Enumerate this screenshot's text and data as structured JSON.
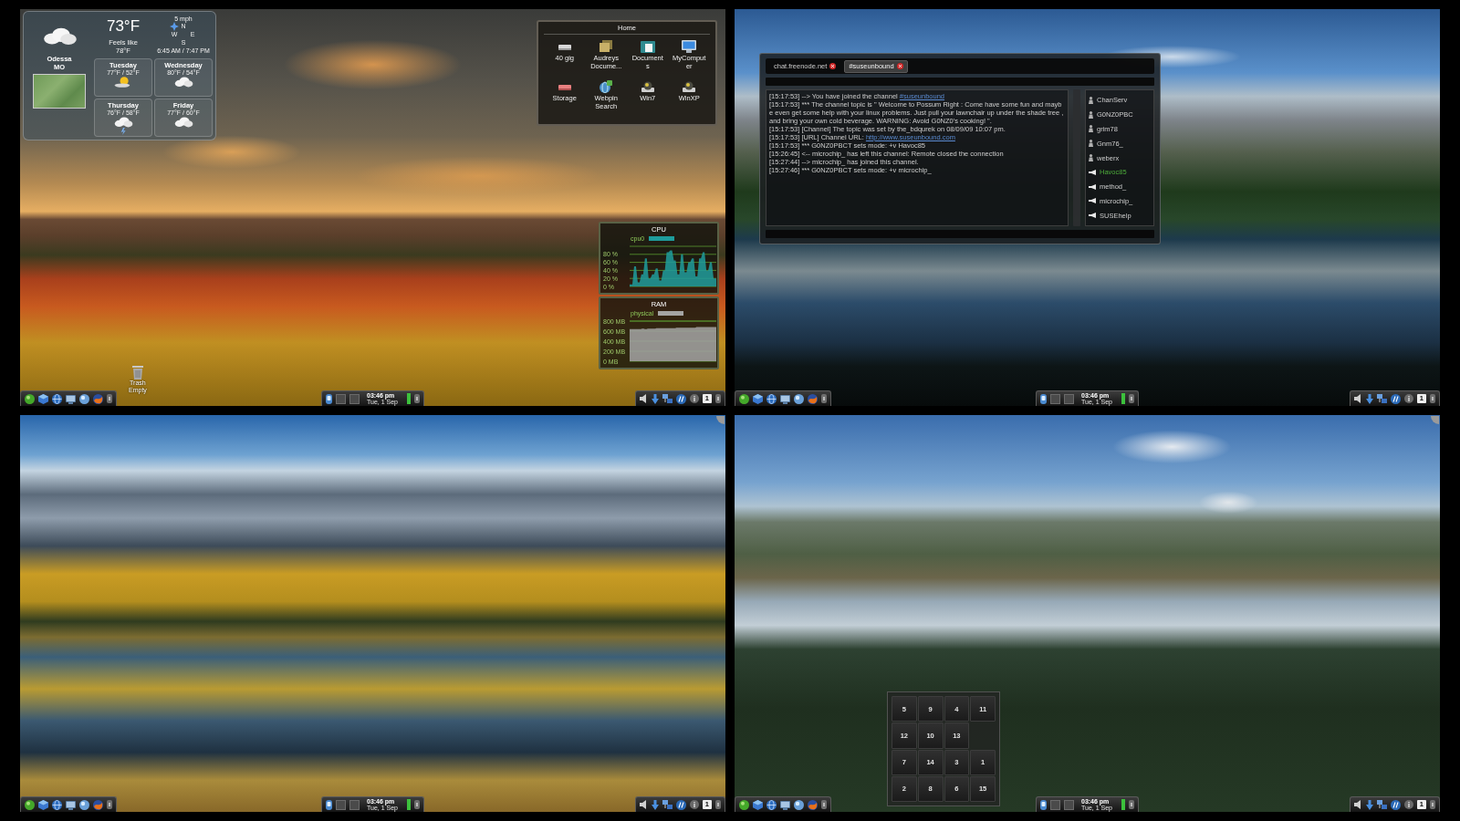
{
  "desktops": [
    {
      "kind": "sunset",
      "toolbox": false,
      "weather": {
        "kind": "cloudy",
        "city": "Odessa",
        "region": "MO",
        "temperature": "73°F",
        "feels_label": "Feels like",
        "feels_value": "78°F",
        "wind": "5 mph",
        "compass": {
          "north": "N",
          "west": "W",
          "east": "E",
          "south": "S"
        },
        "sun_times": "6:45 AM / 7:47 PM",
        "forecast": [
          {
            "day": "Tuesday",
            "temps": "77°F / 52°F",
            "kind": "sunny"
          },
          {
            "day": "Wednesday",
            "temps": "80°F / 54°F",
            "kind": "cloudy"
          },
          {
            "day": "Thursday",
            "temps": "76°F / 58°F",
            "kind": "storm"
          },
          {
            "day": "Friday",
            "temps": "77°F / 60°F",
            "kind": "cloudy"
          }
        ]
      },
      "folder": {
        "title": "Home",
        "items": [
          {
            "label": "40 gig",
            "kind": "drive"
          },
          {
            "label": "Audreys Docume...",
            "kind": "folder"
          },
          {
            "label": "Documents",
            "kind": "documents"
          },
          {
            "label": "MyComputer",
            "kind": "computer"
          },
          {
            "label": "Storage",
            "kind": "storage"
          },
          {
            "label": "Webpin Search",
            "kind": "search"
          },
          {
            "label": "Win7",
            "kind": "system"
          },
          {
            "label": "WinXP",
            "kind": "system"
          }
        ]
      },
      "cpu_monitor": {
        "title": "CPU",
        "chart_data": {
          "type": "area",
          "grid": true,
          "series": [
            {
              "name": "cpu0",
              "color": "#1e9c9c",
              "values": [
                5,
                50,
                10,
                30,
                70,
                20,
                30,
                45,
                15,
                40,
                85,
                90,
                65,
                30,
                80,
                35,
                60,
                70,
                25,
                70,
                85,
                40,
                60,
                20
              ]
            }
          ],
          "ylim": [
            0,
            100
          ],
          "yticks": [
            {
              "value": 0,
              "label": "0 %"
            },
            {
              "value": 20,
              "label": "20 %"
            },
            {
              "value": 40,
              "label": "40 %"
            },
            {
              "value": 60,
              "label": "60 %"
            },
            {
              "value": 80,
              "label": "80 %"
            }
          ]
        }
      },
      "ram_monitor": {
        "title": "RAM",
        "chart_data": {
          "type": "area",
          "grid": true,
          "series": [
            {
              "name": "physical",
              "color": "#a4a4a4",
              "values": [
                640,
                640,
                640,
                640,
                650,
                640,
                650,
                650,
                650,
                660,
                660,
                660,
                660,
                660,
                660,
                660,
                670,
                670,
                670,
                670,
                670,
                670,
                670,
                680,
                680,
                680,
                680,
                680,
                680,
                680
              ]
            }
          ],
          "ylim": [
            0,
            800
          ],
          "yticks": [
            {
              "value": 0,
              "label": "0 MB"
            },
            {
              "value": 200,
              "label": "200 MB"
            },
            {
              "value": 400,
              "label": "400 MB"
            },
            {
              "value": 600,
              "label": "600 MB"
            },
            {
              "value": 800,
              "label": "800 MB"
            }
          ]
        }
      },
      "trash": {
        "name": "Trash",
        "status": "Empty"
      },
      "taskbar": {
        "time": "03:46 pm",
        "date": "Tue, 1 Sep",
        "desktop": "1"
      }
    },
    {
      "kind": "lake",
      "toolbox": false,
      "irc": {
        "tabs": [
          {
            "label": "chat.freenode.net",
            "selected": false
          },
          {
            "label": "#suseunbound",
            "selected": true
          }
        ],
        "messages": [
          {
            "text": "[15:17:53] --> You have joined the channel ",
            "link": "#suseunbound"
          },
          {
            "text": "[15:17:53] *** The channel topic is \" Welcome to Possum Right : Come have some fun and maybe even get some help with your linux problems. Just pull your lawnchair up under the shade tree , and bring your own cold beverage. WARNING: Avoid G0NZ0's cooking! \"."
          },
          {
            "text": "[15:17:53] [Channel] The topic was set by the_bdqurek on 08/09/09 10:07 pm."
          },
          {
            "text": "[15:17:53] [URL] Channel URL: ",
            "link": "http://www.suseunbound.com"
          },
          {
            "text": "[15:17:53] *** G0NZ0PBCT sets mode: +v Havoc85"
          },
          {
            "text": "[15:26:45] <-- microchip_ has left this channel: Remote closed the connection"
          },
          {
            "text": "[15:27:44] --> microchip_ has joined this channel."
          },
          {
            "text": "[15:27:46] *** G0NZ0PBCT sets mode: +v microchip_"
          }
        ],
        "nicks": [
          {
            "name": "ChanServ",
            "kind": "op",
            "self": false
          },
          {
            "name": "G0NZ0PBC",
            "kind": "op",
            "self": false
          },
          {
            "name": "grim78",
            "kind": "op",
            "self": false
          },
          {
            "name": "Gnm76_",
            "kind": "op",
            "self": false
          },
          {
            "name": "weberx",
            "kind": "op",
            "self": false
          },
          {
            "name": "Havoc85",
            "kind": "voice",
            "self": true
          },
          {
            "name": "method_",
            "kind": "voice",
            "self": false
          },
          {
            "name": "microchip_",
            "kind": "voice",
            "self": false
          },
          {
            "name": "SUSEhelp",
            "kind": "voice",
            "self": false
          }
        ]
      },
      "taskbar": {
        "time": "03:46 pm",
        "date": "Tue, 1 Sep",
        "desktop": "1"
      }
    },
    {
      "kind": "aspens",
      "toolbox": true,
      "taskbar": {
        "time": "03:46 pm",
        "date": "Tue, 1 Sep",
        "desktop": "1"
      }
    },
    {
      "kind": "alpine",
      "toolbox": true,
      "puzzle": {
        "tiles": [
          {
            "kind": "tile",
            "label": "5"
          },
          {
            "kind": "tile",
            "label": "9"
          },
          {
            "kind": "tile",
            "label": "4"
          },
          {
            "kind": "tile",
            "label": "11"
          },
          {
            "kind": "tile",
            "label": "12"
          },
          {
            "kind": "tile",
            "label": "10"
          },
          {
            "kind": "tile",
            "label": "13"
          },
          {
            "kind": "gap"
          },
          {
            "kind": "tile",
            "label": "7"
          },
          {
            "kind": "tile",
            "label": "14"
          },
          {
            "kind": "tile",
            "label": "3"
          },
          {
            "kind": "tile",
            "label": "1"
          },
          {
            "kind": "tile",
            "label": "2"
          },
          {
            "kind": "tile",
            "label": "8"
          },
          {
            "kind": "tile",
            "label": "6"
          },
          {
            "kind": "tile",
            "label": "15"
          }
        ]
      },
      "taskbar": {
        "time": "03:46 pm",
        "date": "Tue, 1 Sep",
        "desktop": "1"
      }
    }
  ]
}
